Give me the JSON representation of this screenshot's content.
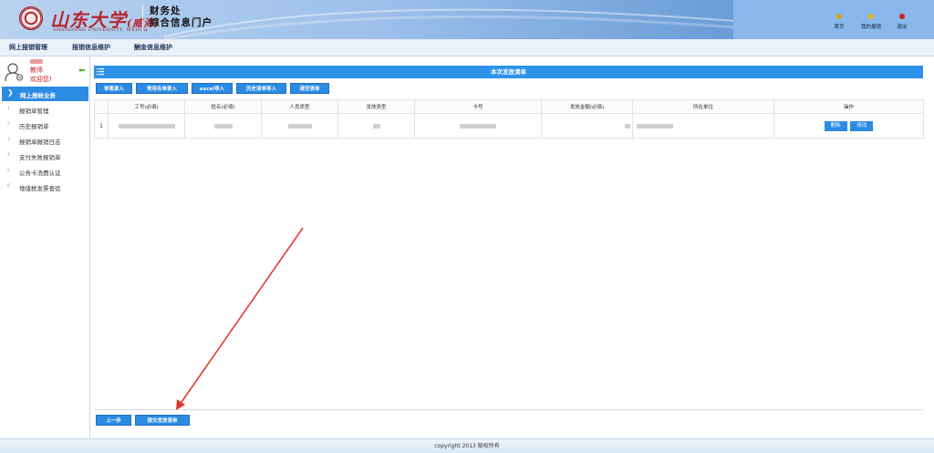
{
  "header": {
    "logo_text": "山东大学",
    "logo_suffix": "(威海)",
    "logo_sub": "SHANDONG UNIVERSITY, WEIHAI",
    "portal_line1": "财务处",
    "portal_line2": "综合信息门户",
    "actions": [
      {
        "label": "首页",
        "icon": "home-bulb-icon",
        "color": "#d4a017"
      },
      {
        "label": "我的报销",
        "icon": "my-reimburse-bulb-icon",
        "color": "#e7b51f"
      },
      {
        "label": "退出",
        "icon": "logout-bulb-icon",
        "color": "#d42020"
      }
    ]
  },
  "tabs": [
    {
      "label": "网上报销管理"
    },
    {
      "label": "报销信息维护"
    },
    {
      "label": "酬金信息维护"
    }
  ],
  "sidebar": {
    "user_role": "教师",
    "welcome": "欢迎您!",
    "active_section": "网上报帐业务",
    "items": [
      {
        "num": "1",
        "label": "报销单管理"
      },
      {
        "num": "2",
        "label": "历史报销单"
      },
      {
        "num": "3",
        "label": "报销单撤销日志"
      },
      {
        "num": "4",
        "label": "支付失败报销单"
      },
      {
        "num": "5",
        "label": "公务卡消费认证"
      },
      {
        "num": "6",
        "label": "增值税发票查验"
      }
    ]
  },
  "panel": {
    "title": "本次发放清单",
    "toolbar": [
      {
        "label": "单笔录入"
      },
      {
        "label": "常用名单录入"
      },
      {
        "label": "excel导入"
      },
      {
        "label": "历史清单导入"
      },
      {
        "label": "清空清单"
      }
    ],
    "columns": [
      "",
      "工号(必填)",
      "姓名(必填)",
      "人员类型",
      "发放类型",
      "卡号",
      "发放金额(必填)",
      "所在单位",
      "操作"
    ],
    "rows": [
      {
        "index": "1",
        "delete_label": "删除",
        "edit_label": "修改"
      }
    ],
    "prev_button": "上一步",
    "submit_button": "提交发放清单"
  },
  "footer": {
    "copyright": "copyright 2013 版权所有"
  },
  "colors": {
    "accent": "#2b8be3",
    "header_bg": "#9dc0ea",
    "brand_red": "#b8252d",
    "annotation_arrow": "#e03a2f"
  }
}
